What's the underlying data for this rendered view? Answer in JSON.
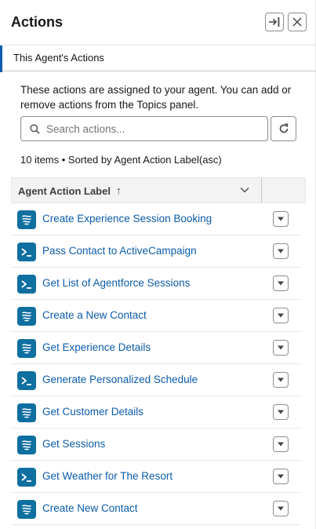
{
  "header": {
    "title": "Actions",
    "dock_icon": "dock-right-icon",
    "close_icon": "close-icon"
  },
  "tabs": [
    {
      "label": "This Agent's Actions",
      "active": true
    }
  ],
  "description": "These actions are assigned to your agent. You can add or remove actions from the Topics panel.",
  "search": {
    "placeholder": "Search actions...",
    "value": ""
  },
  "meta": {
    "summary": "10 items • Sorted by Agent Action Label(asc)"
  },
  "table": {
    "column_header": "Agent Action Label",
    "sort_indicator": "↑",
    "rows": [
      {
        "label": "Create Experience Session Booking",
        "icon": "flow-icon"
      },
      {
        "label": "Pass Contact to ActiveCampaign",
        "icon": "apex-icon"
      },
      {
        "label": "Get List of Agentforce Sessions",
        "icon": "apex-icon"
      },
      {
        "label": "Create a New Contact",
        "icon": "flow-icon"
      },
      {
        "label": "Get Experience Details",
        "icon": "flow-icon"
      },
      {
        "label": "Generate Personalized Schedule",
        "icon": "apex-icon"
      },
      {
        "label": "Get Customer Details",
        "icon": "flow-icon"
      },
      {
        "label": "Get Sessions",
        "icon": "flow-icon"
      },
      {
        "label": "Get Weather for The Resort",
        "icon": "apex-icon"
      },
      {
        "label": "Create New Contact",
        "icon": "flow-icon"
      }
    ]
  },
  "colors": {
    "link": "#0b5cab",
    "icon_bg": "#0e6fa0",
    "tab_accent": "#0b5cab"
  }
}
